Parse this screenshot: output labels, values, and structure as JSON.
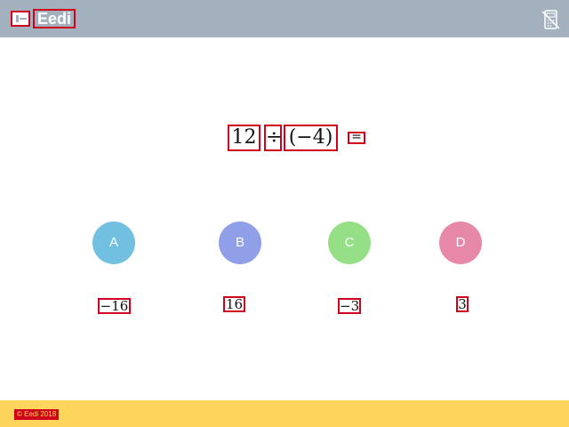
{
  "header": {
    "logo_icon": "eedi-logo-icon",
    "brand": "Eedi",
    "calculator_icon": "calculator-disabled-icon",
    "background_color": "#a3b1bf"
  },
  "question": {
    "left": "12",
    "operator": "÷",
    "right": "(−4)",
    "equals": "="
  },
  "options": [
    {
      "letter": "A",
      "answer": "−16",
      "color": "#72c0e1"
    },
    {
      "letter": "B",
      "answer": "16",
      "color": "#8f9fe8"
    },
    {
      "letter": "C",
      "answer": "−3",
      "color": "#95df86"
    },
    {
      "letter": "D",
      "answer": "3",
      "color": "#e888a9"
    }
  ],
  "footer": {
    "copyright": "© Eedi 2018",
    "background_color": "#ffd55c"
  }
}
